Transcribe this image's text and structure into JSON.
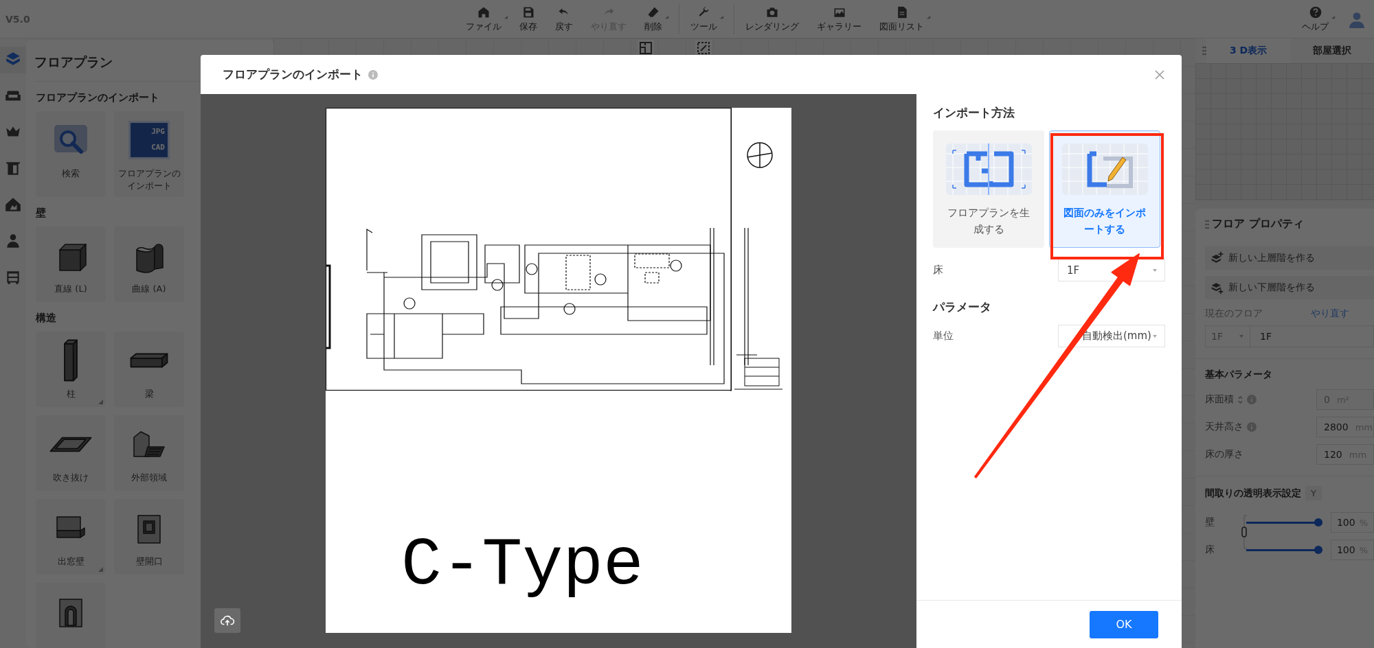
{
  "app": {
    "version": "V5.0",
    "toolbar": [
      {
        "label": "ファイル",
        "kind": "home",
        "dropdown": true,
        "disabled": false,
        "separator_before": false
      },
      {
        "label": "保存",
        "kind": "save",
        "dropdown": false,
        "disabled": false,
        "separator_before": false
      },
      {
        "label": "戻す",
        "kind": "undo",
        "dropdown": false,
        "disabled": false,
        "separator_before": false
      },
      {
        "label": "やり直す",
        "kind": "redo",
        "dropdown": false,
        "disabled": true,
        "separator_before": false
      },
      {
        "label": "削除",
        "kind": "eraser",
        "dropdown": true,
        "disabled": false,
        "separator_before": false
      },
      {
        "label": "ツール",
        "kind": "wrench",
        "dropdown": true,
        "disabled": false,
        "separator_before": true
      },
      {
        "label": "レンダリング",
        "kind": "camera",
        "dropdown": false,
        "disabled": false,
        "separator_before": true
      },
      {
        "label": "ギャラリー",
        "kind": "picture",
        "dropdown": false,
        "disabled": false,
        "separator_before": false
      },
      {
        "label": "図面リスト",
        "kind": "document",
        "dropdown": true,
        "disabled": false,
        "separator_before": false
      }
    ],
    "help": {
      "label": "ヘルプ",
      "dropdown": true
    },
    "rail": [
      {
        "kind": "floorplan",
        "selected": true
      },
      {
        "kind": "sofa",
        "selected": false
      },
      {
        "kind": "crown",
        "selected": false
      },
      {
        "kind": "door",
        "selected": false
      },
      {
        "kind": "house",
        "selected": false
      },
      {
        "kind": "person",
        "selected": false
      },
      {
        "kind": "cabinet",
        "selected": false
      }
    ],
    "left_panel": {
      "title": "フロアプラン",
      "sections": [
        {
          "title": "フロアプランのインポート",
          "tiles": [
            {
              "label": "検索",
              "kind": "search",
              "more": false
            },
            {
              "label": "フロアプランのインポート",
              "kind": "import",
              "badges": [
                "JPG",
                "CAD"
              ],
              "more": false
            }
          ]
        },
        {
          "title": "壁",
          "tiles": [
            {
              "label": "直線 (L)",
              "kind": "cube",
              "more": false
            },
            {
              "label": "曲線 (A)",
              "kind": "curve",
              "more": false
            }
          ]
        },
        {
          "title": "構造",
          "tiles": [
            {
              "label": "柱",
              "kind": "column",
              "more": true
            },
            {
              "label": "梁",
              "kind": "beam",
              "more": false
            },
            {
              "label": "吹き抜け",
              "kind": "void",
              "more": false
            },
            {
              "label": "外部領域",
              "kind": "outdoor",
              "more": false
            },
            {
              "label": "出窓壁",
              "kind": "baywindow",
              "more": true
            },
            {
              "label": "壁開口",
              "kind": "opening",
              "more": false
            },
            {
              "kind": "arch"
            }
          ]
        }
      ]
    },
    "view_tabs": [
      {
        "label": "3 D表示",
        "selected": true
      },
      {
        "label": "部屋選択",
        "selected": false
      }
    ],
    "floor_properties": {
      "title": "フロア プロパティ",
      "actions": [
        {
          "label": "新しい上層階を作る",
          "kind": "layer-up"
        },
        {
          "label": "新しい下層階を作る",
          "kind": "layer-down"
        }
      ],
      "current_floor": {
        "label": "現在のフロア",
        "link": "やり直す",
        "select": "1F",
        "value": "1F"
      },
      "basic": {
        "title": "基本パラメータ",
        "fields": [
          {
            "label": "床面積",
            "value": "0",
            "unit": "m²",
            "disabled": true,
            "sort": true,
            "info": true
          },
          {
            "label": "天井高さ",
            "value": "2800",
            "unit": "mm",
            "disabled": false,
            "sort": false,
            "info": true
          },
          {
            "label": "床の厚さ",
            "value": "120",
            "unit": "mm",
            "disabled": false,
            "sort": false,
            "info": false
          }
        ]
      },
      "transparency": {
        "title": "間取りの透明表示設定",
        "badge": "Y",
        "sliders": [
          {
            "label": "壁",
            "level": 1,
            "value": "100",
            "unit": "%"
          },
          {
            "label": "床",
            "level": 1,
            "value": "100",
            "unit": "%"
          }
        ]
      }
    }
  },
  "dialog": {
    "title": "フロアプランのインポート",
    "preview": {
      "caption": "C-Type"
    },
    "method_title": "インポート方法",
    "methods": [
      {
        "label": "フロアプランを生成する",
        "kind": "generate",
        "selected": false
      },
      {
        "label": "図面のみをインポートする",
        "kind": "trace",
        "selected": true
      }
    ],
    "floor": {
      "label": "床",
      "value": "1F"
    },
    "params_title": "パラメータ",
    "unit": {
      "label": "単位",
      "value": "自動検出(mm)"
    },
    "ok": "OK"
  }
}
